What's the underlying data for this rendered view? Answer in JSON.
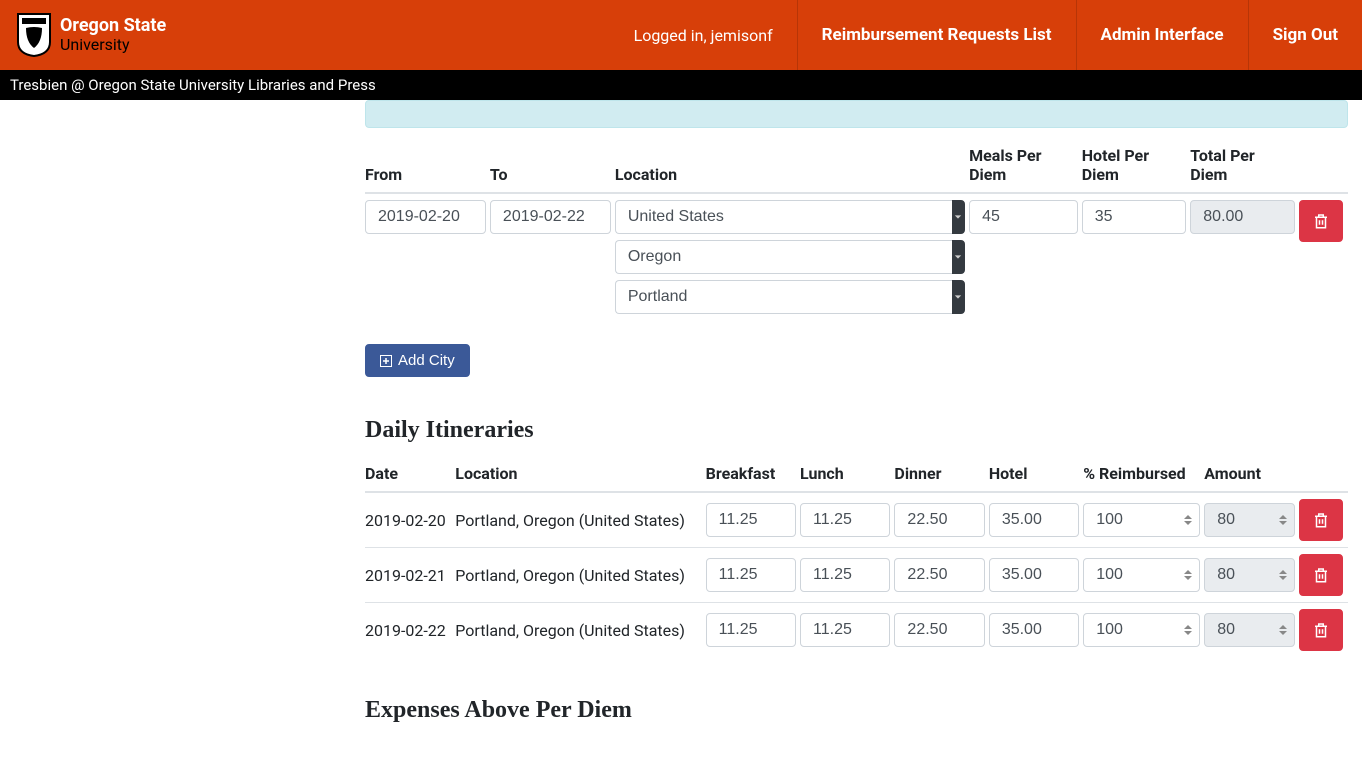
{
  "header": {
    "org_name_line1": "Oregon State",
    "org_name_line2": "University",
    "logged_in_text": "Logged in, jemisonf",
    "nav": {
      "reimbursement": "Reimbursement Requests List",
      "admin": "Admin Interface",
      "signout": "Sign Out"
    }
  },
  "sub_header": {
    "text": "Tresbien @ Oregon State University Libraries and Press"
  },
  "city_section": {
    "headers": {
      "from": "From",
      "to": "To",
      "location": "Location",
      "meals": "Meals Per Diem",
      "hotel": "Hotel Per Diem",
      "total": "Total Per Diem"
    },
    "row": {
      "from": "2019-02-20",
      "to": "2019-02-22",
      "country": "United States",
      "state": "Oregon",
      "city": "Portland",
      "meals": "45",
      "hotel": "35",
      "total": "80.00"
    },
    "add_city_label": "Add City"
  },
  "itineraries": {
    "heading": "Daily Itineraries",
    "headers": {
      "date": "Date",
      "location": "Location",
      "breakfast": "Breakfast",
      "lunch": "Lunch",
      "dinner": "Dinner",
      "hotel": "Hotel",
      "pct": "% Reimbursed",
      "amount": "Amount"
    },
    "rows": [
      {
        "date": "2019-02-20",
        "location": "Portland, Oregon (United States)",
        "breakfast": "11.25",
        "lunch": "11.25",
        "dinner": "22.50",
        "hotel": "35.00",
        "pct": "100",
        "amount": "80"
      },
      {
        "date": "2019-02-21",
        "location": "Portland, Oregon (United States)",
        "breakfast": "11.25",
        "lunch": "11.25",
        "dinner": "22.50",
        "hotel": "35.00",
        "pct": "100",
        "amount": "80"
      },
      {
        "date": "2019-02-22",
        "location": "Portland, Oregon (United States)",
        "breakfast": "11.25",
        "lunch": "11.25",
        "dinner": "22.50",
        "hotel": "35.00",
        "pct": "100",
        "amount": "80"
      }
    ]
  },
  "expenses": {
    "heading": "Expenses Above Per Diem"
  }
}
